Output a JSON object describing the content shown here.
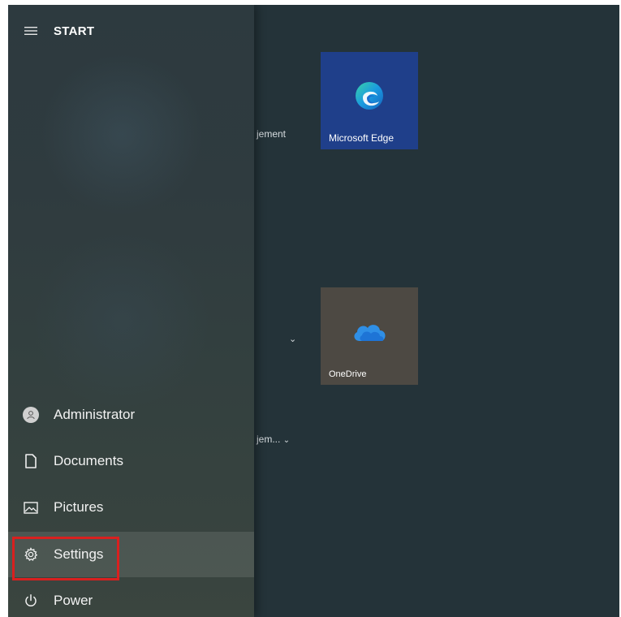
{
  "start_menu": {
    "title": "START",
    "nav_items": [
      {
        "label": "Administrator",
        "icon": "user-avatar-icon"
      },
      {
        "label": "Documents",
        "icon": "document-icon"
      },
      {
        "label": "Pictures",
        "icon": "pictures-icon"
      },
      {
        "label": "Settings",
        "icon": "gear-icon",
        "highlighted": true
      },
      {
        "label": "Power",
        "icon": "power-icon"
      }
    ]
  },
  "background_list": {
    "partial_1": "jement",
    "partial_2": "jem..."
  },
  "tiles": [
    {
      "label": "Microsoft Edge",
      "icon": "edge-icon",
      "color": "#1f3f8a"
    },
    {
      "label": "OneDrive",
      "icon": "onedrive-cloud-icon",
      "color": "#4d4943"
    }
  ],
  "colors": {
    "highlight_border": "#d9201f",
    "edge_tile": "#1f3f8a",
    "onedrive_tile": "#4d4943"
  }
}
